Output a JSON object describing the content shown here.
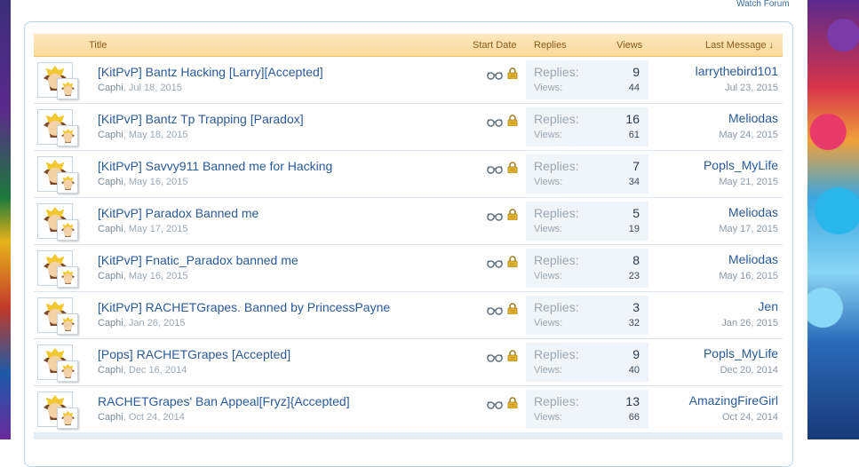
{
  "header": {
    "watch_forum": "Watch Forum"
  },
  "columns": {
    "title": "Title",
    "start_date": "Start Date",
    "replies": "Replies",
    "views": "Views",
    "last_message": "Last Message ↓"
  },
  "labels": {
    "replies": "Replies:",
    "views": "Views:"
  },
  "threads": [
    {
      "title": "[KitPvP] Bantz Hacking [Larry][Accepted]",
      "author": "Caphi",
      "date": "Jul 18, 2015",
      "replies": "9",
      "views": "44",
      "last_user": "larrythebird101",
      "last_date": "Jul 23, 2015"
    },
    {
      "title": "[KitPvP] Bantz Tp Trapping [Paradox]",
      "author": "Caphi",
      "date": "May 18, 2015",
      "replies": "16",
      "views": "61",
      "last_user": "Meliodas",
      "last_date": "May 24, 2015"
    },
    {
      "title": "[KitPvP] Savvy911 Banned me for Hacking",
      "author": "Caphi",
      "date": "May 16, 2015",
      "replies": "7",
      "views": "34",
      "last_user": "Popls_MyLife",
      "last_date": "May 21, 2015"
    },
    {
      "title": "[KitPvP] Paradox Banned me",
      "author": "Caphi",
      "date": "May 17, 2015",
      "replies": "5",
      "views": "19",
      "last_user": "Meliodas",
      "last_date": "May 17, 2015"
    },
    {
      "title": "[KitPvP] Fnatic_Paradox banned me",
      "author": "Caphi",
      "date": "May 16, 2015",
      "replies": "8",
      "views": "23",
      "last_user": "Meliodas",
      "last_date": "May 16, 2015"
    },
    {
      "title": "[KitPvP] RACHETGrapes. Banned by PrincessPayne",
      "author": "Caphi",
      "date": "Jan 26, 2015",
      "replies": "3",
      "views": "32",
      "last_user": "Jen",
      "last_date": "Jan 26, 2015"
    },
    {
      "title": "[Pops] RACHETGrapes [Accepted]",
      "author": "Caphi",
      "date": "Dec 16, 2014",
      "replies": "9",
      "views": "40",
      "last_user": "Popls_MyLife",
      "last_date": "Dec 20, 2014"
    },
    {
      "title": "RACHETGrapes' Ban Appeal[Fryz]{Accepted]",
      "author": "Caphi",
      "date": "Oct 24, 2014",
      "replies": "13",
      "views": "66",
      "last_user": "AmazingFireGirl",
      "last_date": "Oct 24, 2014"
    }
  ],
  "icons": {
    "watched": "glasses-icon",
    "locked": "lock-icon"
  },
  "colors": {
    "header_bg": "#fcd99a",
    "link": "#2a5a9a",
    "border": "#b8d4e8"
  }
}
